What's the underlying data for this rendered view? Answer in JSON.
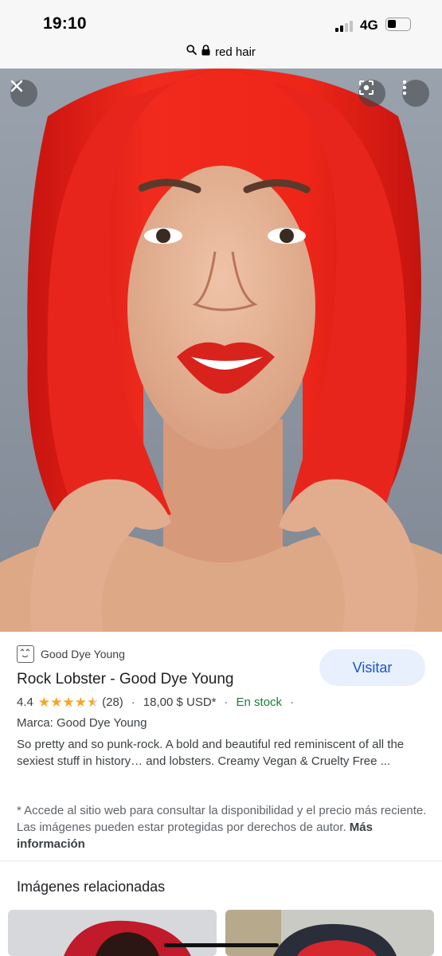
{
  "status_bar": {
    "time": "19:10",
    "network": "4G"
  },
  "url_bar": {
    "text": "red hair",
    "icons": [
      "search-icon",
      "lock-icon"
    ]
  },
  "overlay": {
    "close": "close-icon",
    "lens": "lens-icon",
    "more": "more-vert-icon"
  },
  "result": {
    "source_name": "Good Dye Young",
    "visit_label": "Visitar",
    "title": "Rock Lobster - Good Dye Young",
    "rating": "4.4",
    "rating_value": 4.4,
    "reviews": "(28)",
    "separator": "·",
    "price": "18,00 $ USD*",
    "stock": "En stock",
    "brand": "Marca: Good Dye Young",
    "description": "So pretty and so punk-rock. A bold and beautiful red reminiscent of all the sexiest stuff in history… and lobsters. Creamy Vegan & Cruelty Free ...",
    "disclaimer": "* Accede al sitio web para consultar la disponibilidad y el precio más reciente. Las imágenes pueden estar protegidas por derechos de autor.",
    "more_info": "Más información"
  },
  "related": {
    "title": "Imágenes relacionadas"
  },
  "colors": {
    "accent": "#1a55c4",
    "stock_green": "#188038",
    "star": "#f5a623",
    "hair_red": "#e8251c"
  }
}
